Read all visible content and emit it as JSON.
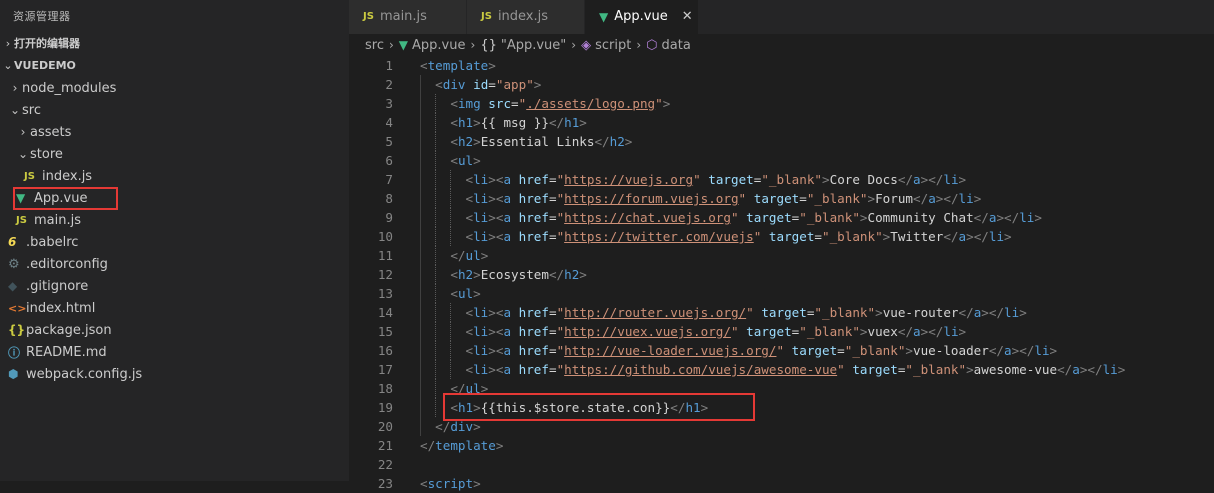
{
  "sidebar": {
    "title": "资源管理器",
    "open_editors": "打开的编辑器",
    "project": "VUEDEMO",
    "tree": [
      {
        "label": "node_modules",
        "depth": 1,
        "chev": "›",
        "icon": ""
      },
      {
        "label": "src",
        "depth": 1,
        "chev": "⌄",
        "icon": ""
      },
      {
        "label": "assets",
        "depth": 2,
        "chev": "›",
        "icon": ""
      },
      {
        "label": "store",
        "depth": 2,
        "chev": "⌄",
        "icon": ""
      },
      {
        "label": "index.js",
        "depth": 3,
        "chev": "",
        "icon": "js"
      },
      {
        "label": "App.vue",
        "depth": 2,
        "chev": "",
        "icon": "vue"
      },
      {
        "label": "main.js",
        "depth": 2,
        "chev": "",
        "icon": "js"
      },
      {
        "label": ".babelrc",
        "depth": 1,
        "chev": "",
        "icon": "babel"
      },
      {
        "label": ".editorconfig",
        "depth": 1,
        "chev": "",
        "icon": "gear"
      },
      {
        "label": ".gitignore",
        "depth": 1,
        "chev": "",
        "icon": "git"
      },
      {
        "label": "index.html",
        "depth": 1,
        "chev": "",
        "icon": "html"
      },
      {
        "label": "package.json",
        "depth": 1,
        "chev": "",
        "icon": "json"
      },
      {
        "label": "README.md",
        "depth": 1,
        "chev": "",
        "icon": "info"
      },
      {
        "label": "webpack.config.js",
        "depth": 1,
        "chev": "",
        "icon": "pack"
      }
    ]
  },
  "tabs": [
    {
      "label": "main.js",
      "icon": "JS"
    },
    {
      "label": "index.js",
      "icon": "JS"
    },
    {
      "label": "App.vue",
      "icon": "V",
      "active": true
    }
  ],
  "breadcrumb": [
    "src",
    "App.vue",
    "\"App.vue\"",
    "script",
    "data"
  ],
  "icons": {
    "js": "JS",
    "vue": "▼",
    "close": "✕"
  },
  "colors": {
    "highlight_box": "#e53935",
    "vue_green": "#41b883",
    "js_yellow": "#cbcb41"
  },
  "code": {
    "line_numbers": [
      "1",
      "2",
      "3",
      "4",
      "5",
      "6",
      "7",
      "8",
      "9",
      "10",
      "11",
      "12",
      "13",
      "14",
      "15",
      "16",
      "17",
      "18",
      "19",
      "20",
      "21",
      "22",
      "23"
    ],
    "lines": [
      [
        [
          "br",
          "<"
        ],
        [
          "tag",
          "template"
        ],
        [
          "br",
          ">"
        ]
      ],
      [
        [
          "t",
          "  "
        ],
        [
          "br",
          "<"
        ],
        [
          "tag",
          "div"
        ],
        [
          "t",
          " "
        ],
        [
          "attr",
          "id"
        ],
        [
          "t",
          "="
        ],
        [
          "str",
          "\"app\""
        ],
        [
          "br",
          ">"
        ]
      ],
      [
        [
          "t",
          "    "
        ],
        [
          "br",
          "<"
        ],
        [
          "tag",
          "img"
        ],
        [
          "t",
          " "
        ],
        [
          "attr",
          "src"
        ],
        [
          "t",
          "="
        ],
        [
          "str",
          "\""
        ],
        [
          "url",
          "./assets/logo.png"
        ],
        [
          "str",
          "\""
        ],
        [
          "br",
          ">"
        ]
      ],
      [
        [
          "t",
          "    "
        ],
        [
          "br",
          "<"
        ],
        [
          "tag",
          "h1"
        ],
        [
          "br",
          ">"
        ],
        [
          "t",
          "{{ msg }}"
        ],
        [
          "br",
          "</"
        ],
        [
          "tag",
          "h1"
        ],
        [
          "br",
          ">"
        ]
      ],
      [
        [
          "t",
          "    "
        ],
        [
          "br",
          "<"
        ],
        [
          "tag",
          "h2"
        ],
        [
          "br",
          ">"
        ],
        [
          "t",
          "Essential Links"
        ],
        [
          "br",
          "</"
        ],
        [
          "tag",
          "h2"
        ],
        [
          "br",
          ">"
        ]
      ],
      [
        [
          "t",
          "    "
        ],
        [
          "br",
          "<"
        ],
        [
          "tag",
          "ul"
        ],
        [
          "br",
          ">"
        ]
      ],
      [
        [
          "t",
          "      "
        ],
        [
          "br",
          "<"
        ],
        [
          "tag",
          "li"
        ],
        [
          "br",
          "><"
        ],
        [
          "tag",
          "a"
        ],
        [
          "t",
          " "
        ],
        [
          "attr",
          "href"
        ],
        [
          "t",
          "="
        ],
        [
          "str",
          "\""
        ],
        [
          "url",
          "https://vuejs.org"
        ],
        [
          "str",
          "\""
        ],
        [
          "t",
          " "
        ],
        [
          "attr",
          "target"
        ],
        [
          "t",
          "="
        ],
        [
          "str",
          "\"_blank\""
        ],
        [
          "br",
          ">"
        ],
        [
          "t",
          "Core Docs"
        ],
        [
          "br",
          "</"
        ],
        [
          "tag",
          "a"
        ],
        [
          "br",
          "></"
        ],
        [
          "tag",
          "li"
        ],
        [
          "br",
          ">"
        ]
      ],
      [
        [
          "t",
          "      "
        ],
        [
          "br",
          "<"
        ],
        [
          "tag",
          "li"
        ],
        [
          "br",
          "><"
        ],
        [
          "tag",
          "a"
        ],
        [
          "t",
          " "
        ],
        [
          "attr",
          "href"
        ],
        [
          "t",
          "="
        ],
        [
          "str",
          "\""
        ],
        [
          "url",
          "https://forum.vuejs.org"
        ],
        [
          "str",
          "\""
        ],
        [
          "t",
          " "
        ],
        [
          "attr",
          "target"
        ],
        [
          "t",
          "="
        ],
        [
          "str",
          "\"_blank\""
        ],
        [
          "br",
          ">"
        ],
        [
          "t",
          "Forum"
        ],
        [
          "br",
          "</"
        ],
        [
          "tag",
          "a"
        ],
        [
          "br",
          "></"
        ],
        [
          "tag",
          "li"
        ],
        [
          "br",
          ">"
        ]
      ],
      [
        [
          "t",
          "      "
        ],
        [
          "br",
          "<"
        ],
        [
          "tag",
          "li"
        ],
        [
          "br",
          "><"
        ],
        [
          "tag",
          "a"
        ],
        [
          "t",
          " "
        ],
        [
          "attr",
          "href"
        ],
        [
          "t",
          "="
        ],
        [
          "str",
          "\""
        ],
        [
          "url",
          "https://chat.vuejs.org"
        ],
        [
          "str",
          "\""
        ],
        [
          "t",
          " "
        ],
        [
          "attr",
          "target"
        ],
        [
          "t",
          "="
        ],
        [
          "str",
          "\"_blank\""
        ],
        [
          "br",
          ">"
        ],
        [
          "t",
          "Community Chat"
        ],
        [
          "br",
          "</"
        ],
        [
          "tag",
          "a"
        ],
        [
          "br",
          "></"
        ],
        [
          "tag",
          "li"
        ],
        [
          "br",
          ">"
        ]
      ],
      [
        [
          "t",
          "      "
        ],
        [
          "br",
          "<"
        ],
        [
          "tag",
          "li"
        ],
        [
          "br",
          "><"
        ],
        [
          "tag",
          "a"
        ],
        [
          "t",
          " "
        ],
        [
          "attr",
          "href"
        ],
        [
          "t",
          "="
        ],
        [
          "str",
          "\""
        ],
        [
          "url",
          "https://twitter.com/vuejs"
        ],
        [
          "str",
          "\""
        ],
        [
          "t",
          " "
        ],
        [
          "attr",
          "target"
        ],
        [
          "t",
          "="
        ],
        [
          "str",
          "\"_blank\""
        ],
        [
          "br",
          ">"
        ],
        [
          "t",
          "Twitter"
        ],
        [
          "br",
          "</"
        ],
        [
          "tag",
          "a"
        ],
        [
          "br",
          "></"
        ],
        [
          "tag",
          "li"
        ],
        [
          "br",
          ">"
        ]
      ],
      [
        [
          "t",
          "    "
        ],
        [
          "br",
          "</"
        ],
        [
          "tag",
          "ul"
        ],
        [
          "br",
          ">"
        ]
      ],
      [
        [
          "t",
          "    "
        ],
        [
          "br",
          "<"
        ],
        [
          "tag",
          "h2"
        ],
        [
          "br",
          ">"
        ],
        [
          "t",
          "Ecosystem"
        ],
        [
          "br",
          "</"
        ],
        [
          "tag",
          "h2"
        ],
        [
          "br",
          ">"
        ]
      ],
      [
        [
          "t",
          "    "
        ],
        [
          "br",
          "<"
        ],
        [
          "tag",
          "ul"
        ],
        [
          "br",
          ">"
        ]
      ],
      [
        [
          "t",
          "      "
        ],
        [
          "br",
          "<"
        ],
        [
          "tag",
          "li"
        ],
        [
          "br",
          "><"
        ],
        [
          "tag",
          "a"
        ],
        [
          "t",
          " "
        ],
        [
          "attr",
          "href"
        ],
        [
          "t",
          "="
        ],
        [
          "str",
          "\""
        ],
        [
          "url",
          "http://router.vuejs.org/"
        ],
        [
          "str",
          "\""
        ],
        [
          "t",
          " "
        ],
        [
          "attr",
          "target"
        ],
        [
          "t",
          "="
        ],
        [
          "str",
          "\"_blank\""
        ],
        [
          "br",
          ">"
        ],
        [
          "t",
          "vue-router"
        ],
        [
          "br",
          "</"
        ],
        [
          "tag",
          "a"
        ],
        [
          "br",
          "></"
        ],
        [
          "tag",
          "li"
        ],
        [
          "br",
          ">"
        ]
      ],
      [
        [
          "t",
          "      "
        ],
        [
          "br",
          "<"
        ],
        [
          "tag",
          "li"
        ],
        [
          "br",
          "><"
        ],
        [
          "tag",
          "a"
        ],
        [
          "t",
          " "
        ],
        [
          "attr",
          "href"
        ],
        [
          "t",
          "="
        ],
        [
          "str",
          "\""
        ],
        [
          "url",
          "http://vuex.vuejs.org/"
        ],
        [
          "str",
          "\""
        ],
        [
          "t",
          " "
        ],
        [
          "attr",
          "target"
        ],
        [
          "t",
          "="
        ],
        [
          "str",
          "\"_blank\""
        ],
        [
          "br",
          ">"
        ],
        [
          "t",
          "vuex"
        ],
        [
          "br",
          "</"
        ],
        [
          "tag",
          "a"
        ],
        [
          "br",
          "></"
        ],
        [
          "tag",
          "li"
        ],
        [
          "br",
          ">"
        ]
      ],
      [
        [
          "t",
          "      "
        ],
        [
          "br",
          "<"
        ],
        [
          "tag",
          "li"
        ],
        [
          "br",
          "><"
        ],
        [
          "tag",
          "a"
        ],
        [
          "t",
          " "
        ],
        [
          "attr",
          "href"
        ],
        [
          "t",
          "="
        ],
        [
          "str",
          "\""
        ],
        [
          "url",
          "http://vue-loader.vuejs.org/"
        ],
        [
          "str",
          "\""
        ],
        [
          "t",
          " "
        ],
        [
          "attr",
          "target"
        ],
        [
          "t",
          "="
        ],
        [
          "str",
          "\"_blank\""
        ],
        [
          "br",
          ">"
        ],
        [
          "t",
          "vue-loader"
        ],
        [
          "br",
          "</"
        ],
        [
          "tag",
          "a"
        ],
        [
          "br",
          "></"
        ],
        [
          "tag",
          "li"
        ],
        [
          "br",
          ">"
        ]
      ],
      [
        [
          "t",
          "      "
        ],
        [
          "br",
          "<"
        ],
        [
          "tag",
          "li"
        ],
        [
          "br",
          "><"
        ],
        [
          "tag",
          "a"
        ],
        [
          "t",
          " "
        ],
        [
          "attr",
          "href"
        ],
        [
          "t",
          "="
        ],
        [
          "str",
          "\""
        ],
        [
          "url",
          "https://github.com/vuejs/awesome-vue"
        ],
        [
          "str",
          "\""
        ],
        [
          "t",
          " "
        ],
        [
          "attr",
          "target"
        ],
        [
          "t",
          "="
        ],
        [
          "str",
          "\"_blank\""
        ],
        [
          "br",
          ">"
        ],
        [
          "t",
          "awesome-vue"
        ],
        [
          "br",
          "</"
        ],
        [
          "tag",
          "a"
        ],
        [
          "br",
          "></"
        ],
        [
          "tag",
          "li"
        ],
        [
          "br",
          ">"
        ]
      ],
      [
        [
          "t",
          "    "
        ],
        [
          "br",
          "</"
        ],
        [
          "tag",
          "ul"
        ],
        [
          "br",
          ">"
        ]
      ],
      [
        [
          "t",
          "    "
        ],
        [
          "br",
          "<"
        ],
        [
          "tag",
          "h1"
        ],
        [
          "br",
          ">"
        ],
        [
          "t",
          "{{this.$store.state.con}}"
        ],
        [
          "br",
          "</"
        ],
        [
          "tag",
          "h1"
        ],
        [
          "br",
          ">"
        ]
      ],
      [
        [
          "t",
          "  "
        ],
        [
          "br",
          "</"
        ],
        [
          "tag",
          "div"
        ],
        [
          "br",
          ">"
        ]
      ],
      [
        [
          "br",
          "</"
        ],
        [
          "tag",
          "template"
        ],
        [
          "br",
          ">"
        ]
      ],
      [],
      [
        [
          "br",
          "<"
        ],
        [
          "tag",
          "script"
        ],
        [
          "br",
          ">"
        ]
      ]
    ]
  }
}
